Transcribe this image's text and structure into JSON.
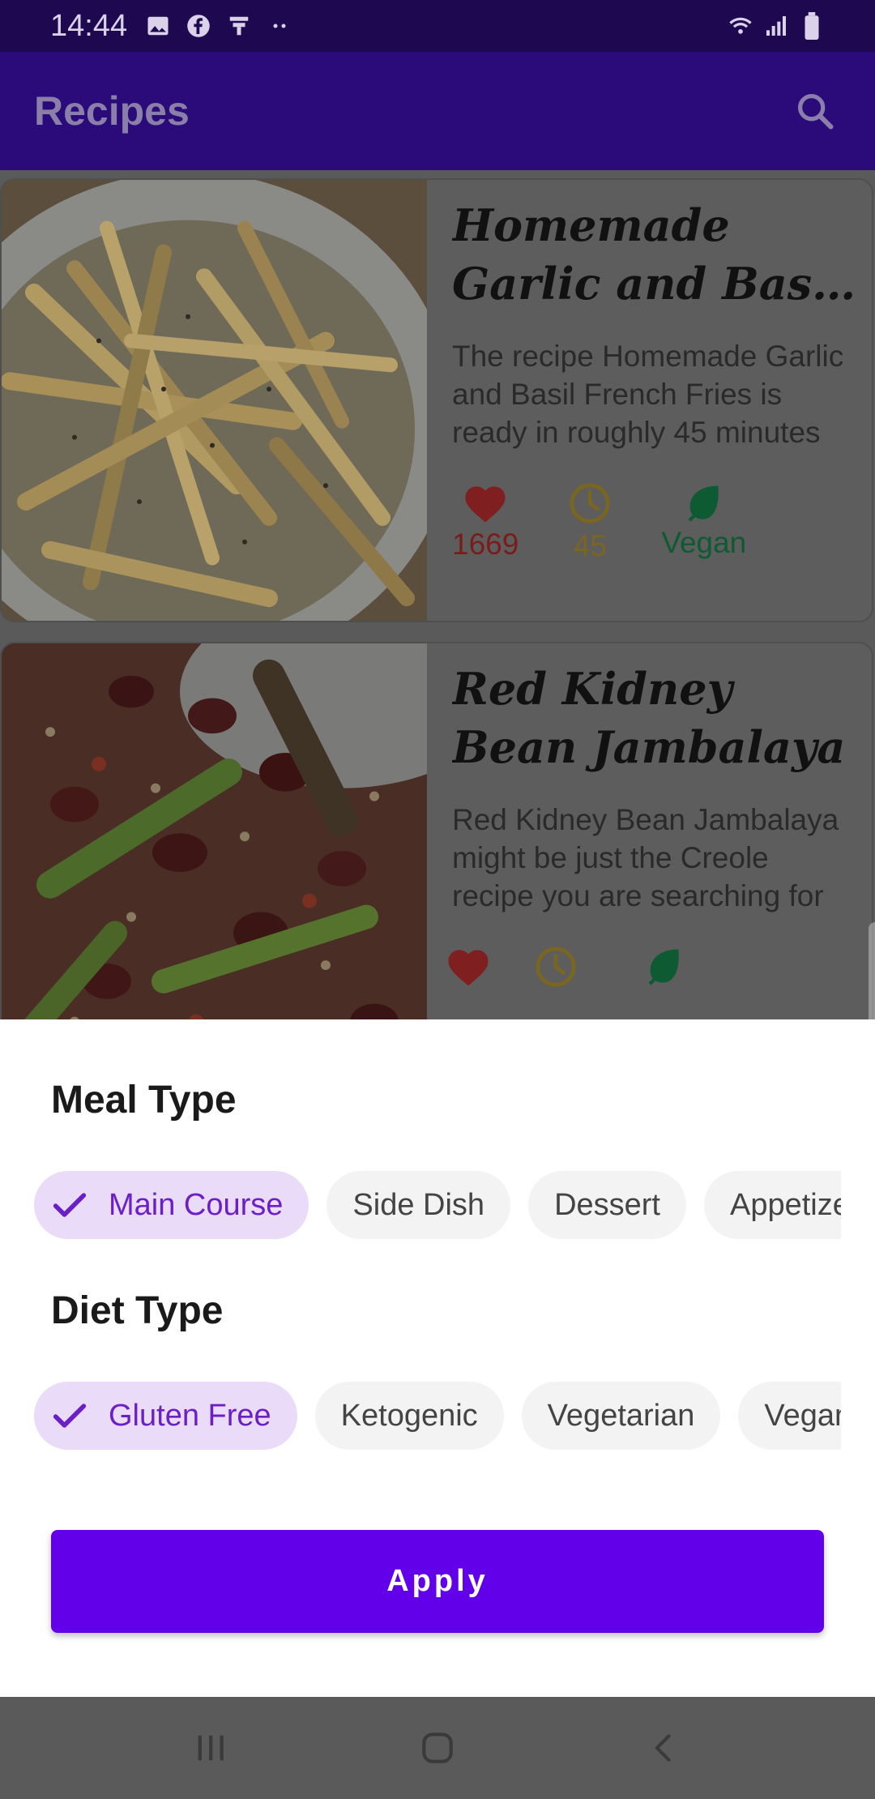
{
  "status_bar": {
    "time": "14:44",
    "left_icons": [
      "image-icon",
      "facebook-icon",
      "notification-icon",
      "more-dots-icon"
    ],
    "right_icons": [
      "wifi-icon",
      "signal-icon",
      "battery-icon"
    ]
  },
  "app_bar": {
    "title": "Recipes",
    "search_icon": "search-icon"
  },
  "recipes": [
    {
      "title": "Homemade Garlic and Basil French Fries",
      "description": "The recipe Homemade Garlic and Basil French Fries is ready in roughly 45 minutes",
      "likes": "1669",
      "minutes": "45",
      "diet": "Vegan",
      "image": "french-fries-photo"
    },
    {
      "title": "Red Kidney Bean Jambalaya",
      "description": "Red Kidney Bean Jambalaya might be just the Creole recipe you are searching for",
      "image": "jambalaya-photo"
    }
  ],
  "filter_sheet": {
    "meal_type_title": "Meal Type",
    "meal_types": [
      "Main Course",
      "Side Dish",
      "Dessert",
      "Appetizer"
    ],
    "meal_selected": "Main Course",
    "diet_type_title": "Diet Type",
    "diet_types": [
      "Gluten Free",
      "Ketogenic",
      "Vegetarian",
      "Vegan"
    ],
    "diet_selected": "Gluten Free",
    "apply_label": "Apply"
  },
  "colors": {
    "primary": "#6200ea",
    "chip_selected_bg": "#eadcf8",
    "chip_selected_text": "#6a1fc7",
    "like_red": "#d32f2f",
    "time_yellow": "#d4a012",
    "vegan_green": "#0f9d58"
  },
  "nav_bar": [
    "recent-apps-icon",
    "home-icon",
    "back-icon"
  ]
}
